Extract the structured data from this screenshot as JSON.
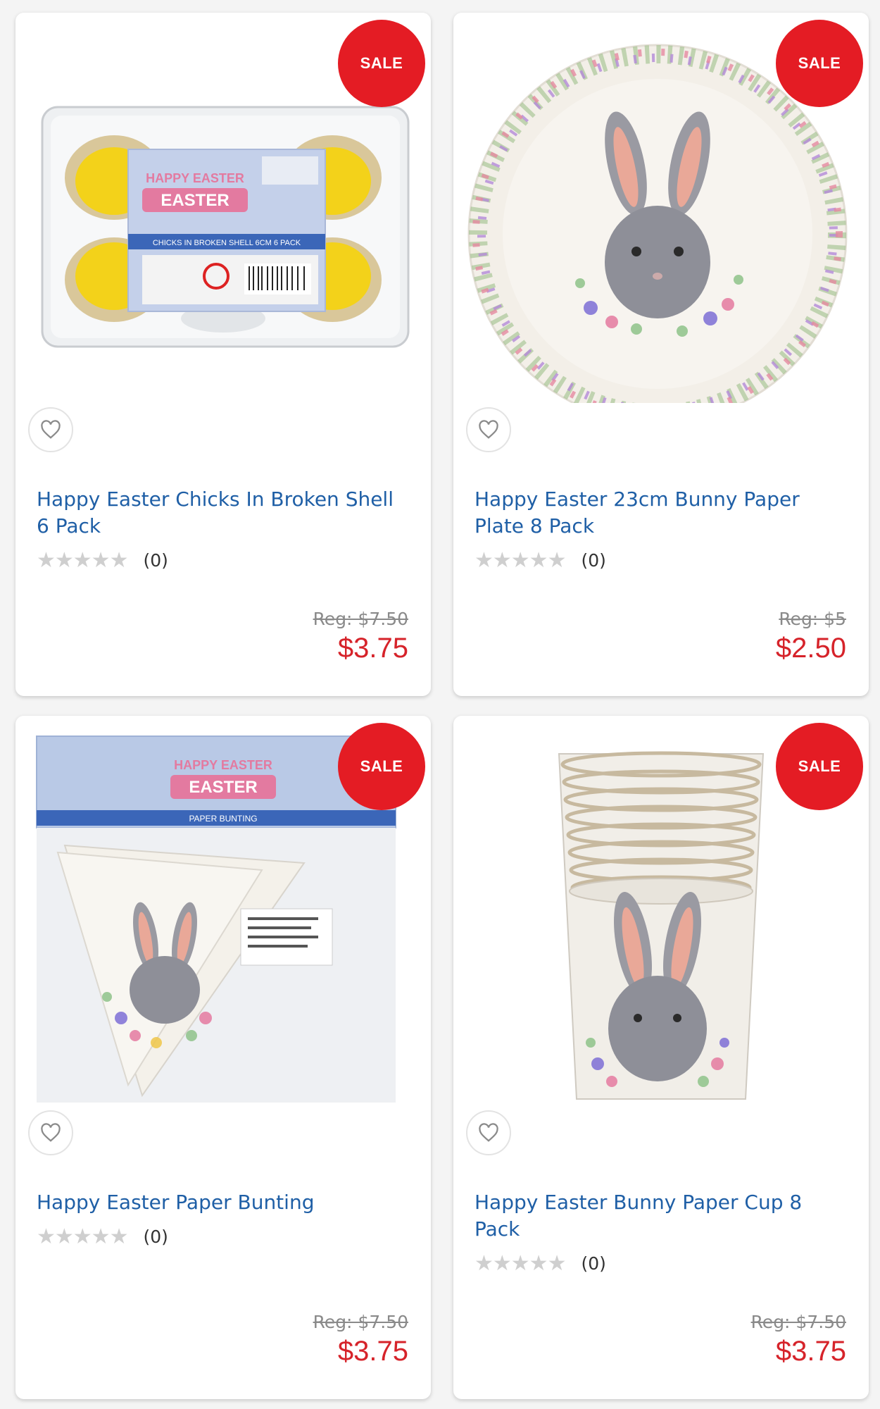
{
  "products": [
    {
      "badge": "SALE",
      "title": "Happy Easter Chicks In Broken Shell 6 Pack",
      "stars": "★★★★★",
      "review_count": "(0)",
      "reg_price": "Reg: $7.50",
      "price": "$3.75",
      "image_label": "HAPPY EASTER",
      "image_sublabel": "CHICKS IN BROKEN SHELL 6CM 6 PACK"
    },
    {
      "badge": "SALE",
      "title": "Happy Easter 23cm Bunny Paper Plate 8 Pack",
      "stars": "★★★★★",
      "review_count": "(0)",
      "reg_price": "Reg: $5",
      "price": "$2.50"
    },
    {
      "badge": "SALE",
      "title": "Happy Easter Paper Bunting",
      "stars": "★★★★★",
      "review_count": "(0)",
      "reg_price": "Reg: $7.50",
      "price": "$3.75",
      "image_label": "HAPPY EASTER",
      "image_sublabel": "PAPER BUNTING"
    },
    {
      "badge": "SALE",
      "title": "Happy Easter Bunny Paper Cup 8 Pack",
      "stars": "★★★★★",
      "review_count": "(0)",
      "reg_price": "Reg: $7.50",
      "price": "$3.75"
    }
  ],
  "colors": {
    "sale_badge": "#e41c24",
    "title_link": "#1f5fa6",
    "sale_price": "#d6232a"
  }
}
